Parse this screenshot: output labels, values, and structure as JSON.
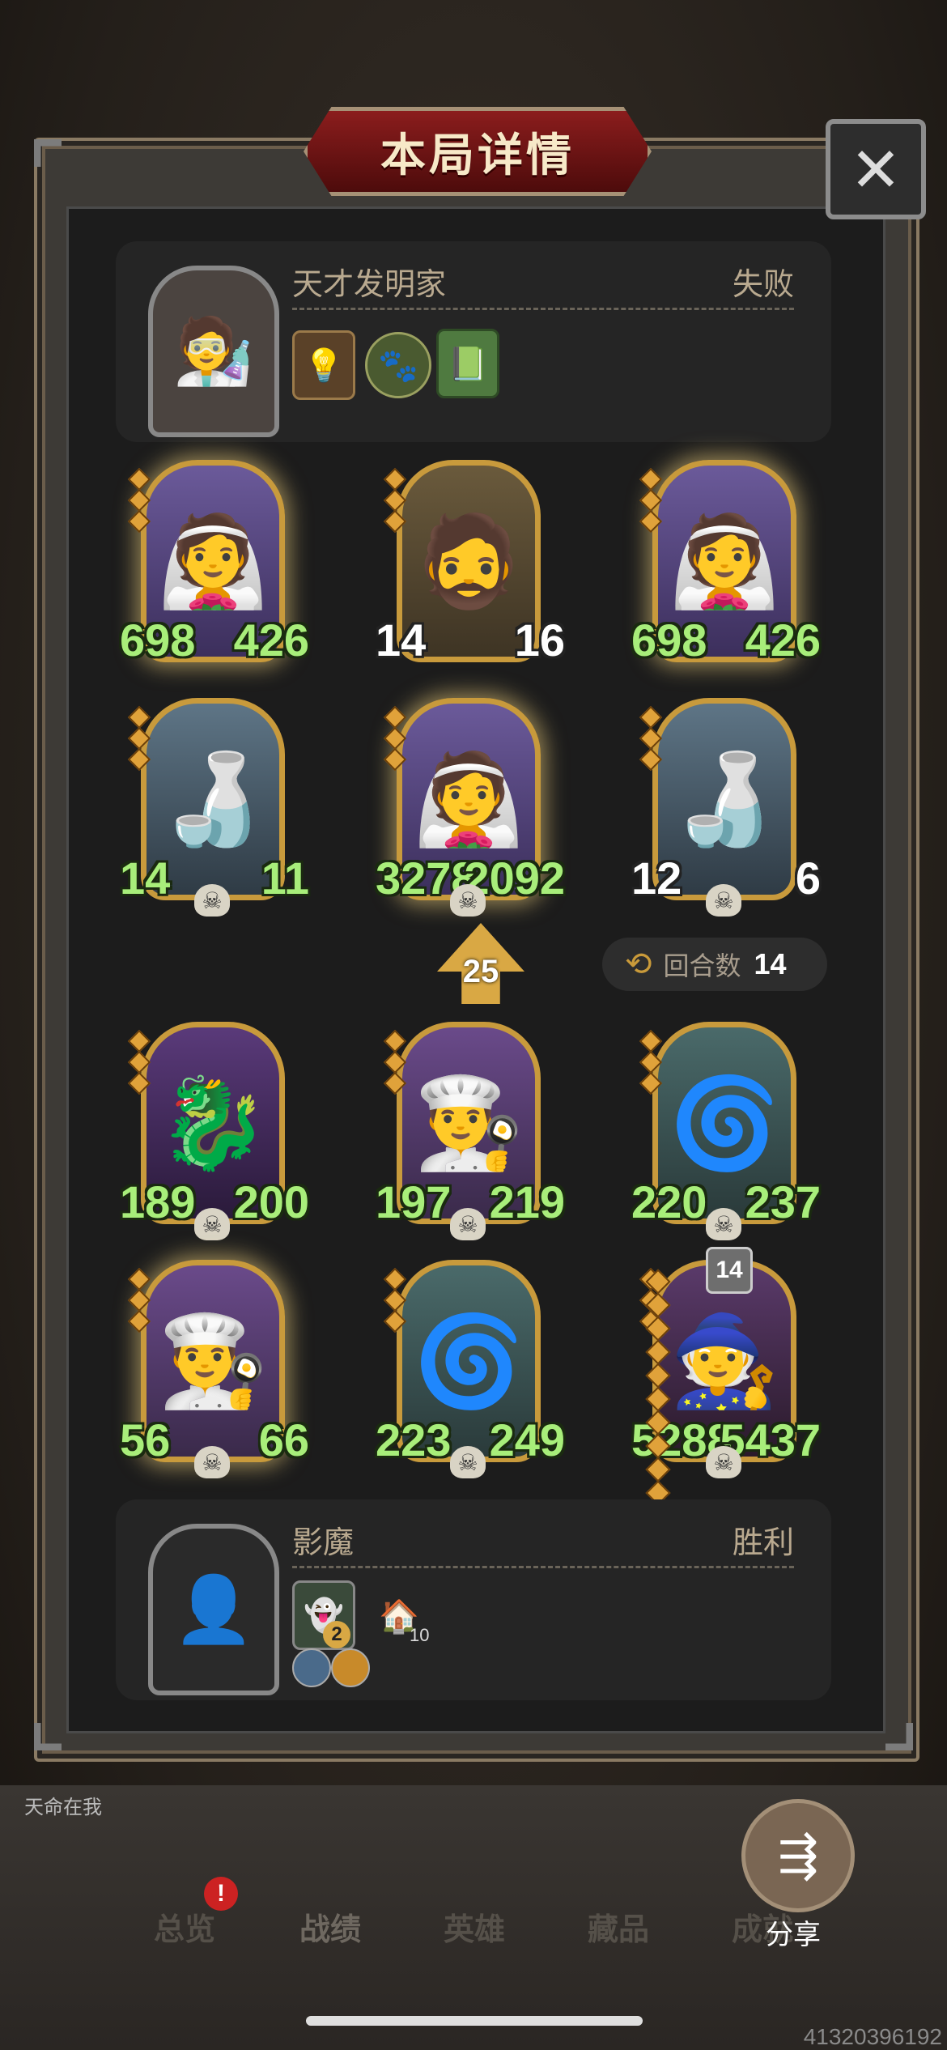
{
  "title": "本局详情",
  "close_icon": "close-icon",
  "top_player": {
    "name": "天才发明家",
    "result": "失败",
    "items": [
      "lightbulb-icon",
      "creature-token-icon",
      "green-book-icon"
    ]
  },
  "top_board": [
    {
      "atk": "698",
      "hp": "426",
      "art": "ghost-bride",
      "atk_white": false
    },
    {
      "atk": "14",
      "hp": "16",
      "art": "green-knight",
      "atk_white": true
    },
    {
      "atk": "698",
      "hp": "426",
      "art": "ghost-bride",
      "atk_white": false
    },
    {
      "atk": "14",
      "hp": "11",
      "art": "bottle-reader",
      "atk_white": false
    },
    {
      "atk": "3278",
      "hp": "2092",
      "art": "ghost-bride",
      "atk_white": false
    },
    {
      "atk": "12",
      "hp": "6",
      "art": "bottle-reader",
      "atk_white": true
    }
  ],
  "tier": "25",
  "round": {
    "label": "回合数",
    "value": "14"
  },
  "bottom_board": [
    {
      "atk": "189",
      "hp": "200",
      "art": "shadow-dragon"
    },
    {
      "atk": "197",
      "hp": "219",
      "art": "old-chef"
    },
    {
      "atk": "220",
      "hp": "237",
      "art": "green-vortex"
    },
    {
      "atk": "56",
      "hp": "66",
      "art": "old-chef"
    },
    {
      "atk": "223",
      "hp": "249",
      "art": "green-vortex"
    },
    {
      "atk": "5288",
      "hp": "5437",
      "art": "hooded-cultist"
    }
  ],
  "badge": "14",
  "bottom_player": {
    "name": "影魔",
    "result": "胜利",
    "item_count_a": "2",
    "item_count_b": "10"
  },
  "ticker": "天命在我",
  "tabs": [
    "总览",
    "战绩",
    "英雄",
    "藏品",
    "成就"
  ],
  "share_label": "分享",
  "uid": "41320396192"
}
